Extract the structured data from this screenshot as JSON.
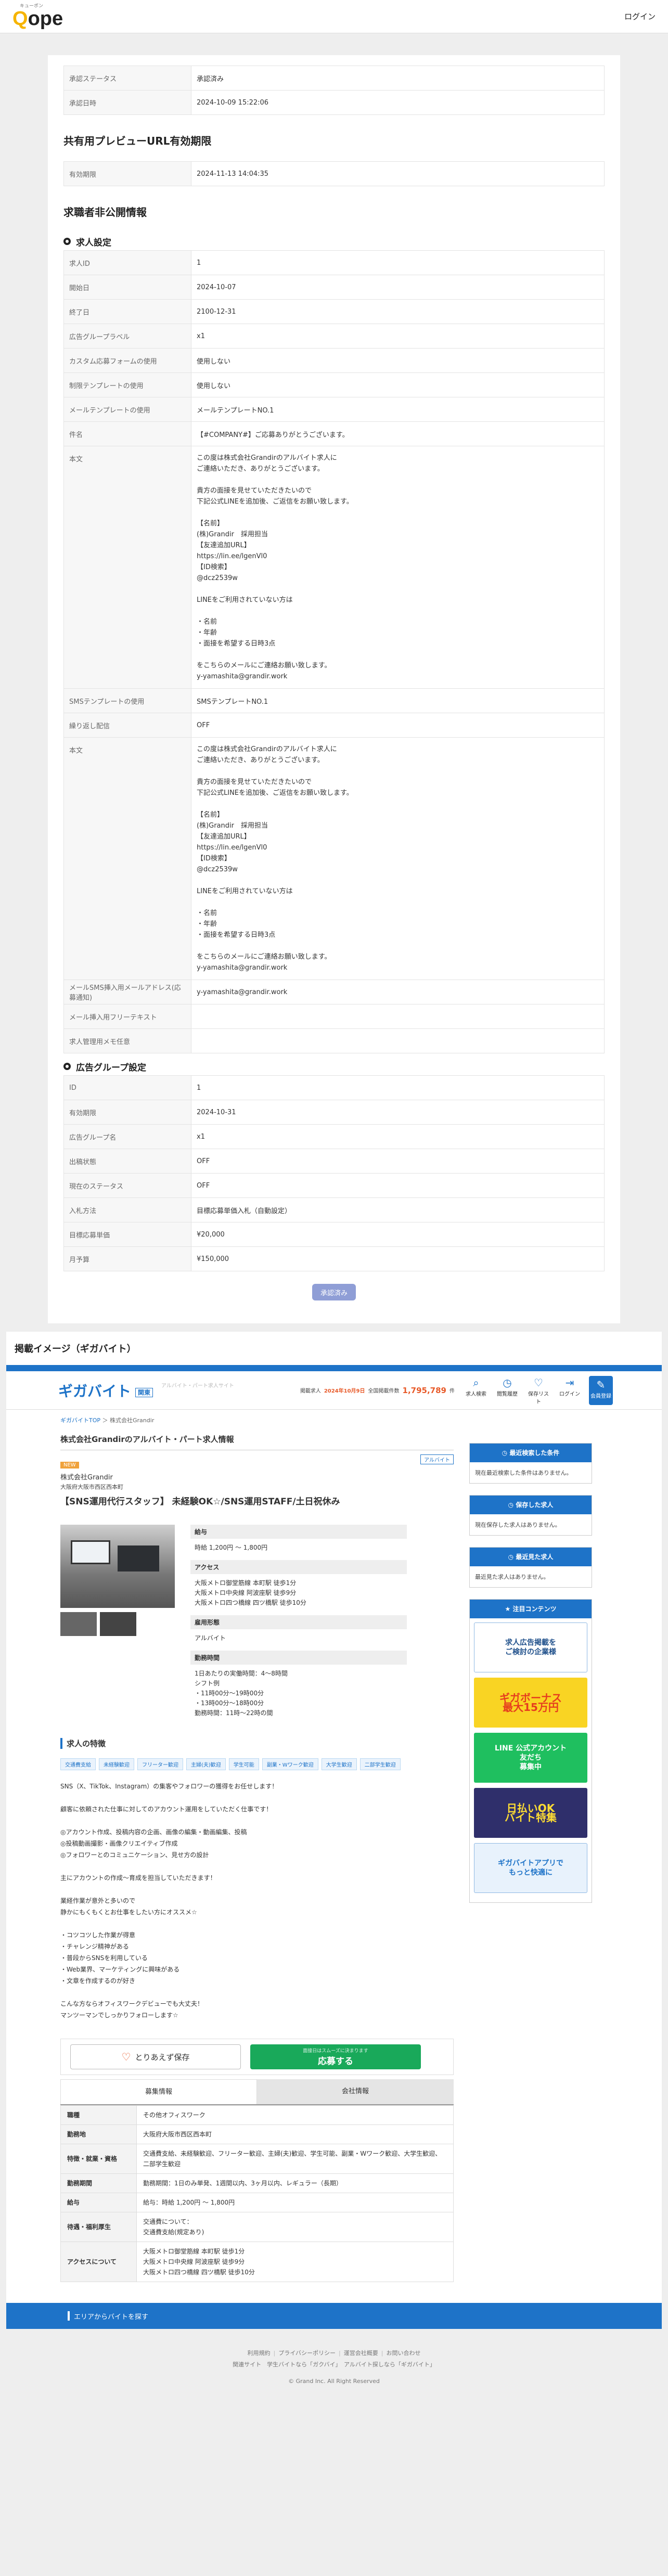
{
  "header": {
    "logo_kana": "キューポン",
    "logo_text": "Qope",
    "login": "ログイン"
  },
  "approval": {
    "rows": [
      {
        "k": "承認ステータス",
        "v": "承認済み"
      },
      {
        "k": "承認日時",
        "v": "2024-10-09 15:22:06"
      }
    ]
  },
  "preview_url": {
    "title": "共有用プレビューURL有効期限",
    "rows": [
      {
        "k": "有効期限",
        "v": "2024-11-13 14:04:35"
      }
    ]
  },
  "private_info": {
    "title": "求職者非公開情報",
    "job_settings": {
      "title": "求人設定",
      "rows": [
        {
          "k": "求人ID",
          "v": "1"
        },
        {
          "k": "開始日",
          "v": "2024-10-07"
        },
        {
          "k": "終了日",
          "v": "2100-12-31"
        },
        {
          "k": "広告グループラベル",
          "v": "x1"
        },
        {
          "k": "カスタム応募フォームの使用",
          "v": "使用しない"
        },
        {
          "k": "制限テンプレートの使用",
          "v": "使用しない"
        },
        {
          "k": "メールテンプレートの使用",
          "v": "メールテンプレートNO.1"
        },
        {
          "k": "件名",
          "v": "【#COMPANY#】ご応募ありがとうございます。"
        },
        {
          "k": "本文",
          "v": "この度は株式会社Grandirのアルバイト求人に\nご連絡いただき、ありがとうございます。\n\n貴方の面接を見せていただきたいので\n下記公式LINEを追加後、ご返信をお願い致します。\n\n【名前】\n(株)Grandir　採用担当\n【友達追加URL】\nhttps://lin.ee/lgenVl0\n【ID検索】\n@dcz2539w\n\nLINEをご利用されていない方は\n\n・名前\n・年齢\n・面接を希望する日時3点\n\nをこちらのメールにご連絡お願い致します。\ny-yamashita@grandir.work"
        },
        {
          "k": "SMSテンプレートの使用",
          "v": "SMSテンプレートNO.1"
        },
        {
          "k": "繰り返し配信",
          "v": "OFF"
        },
        {
          "k": "本文",
          "v": "この度は株式会社Grandirのアルバイト求人に\nご連絡いただき、ありがとうございます。\n\n貴方の面接を見せていただきたいので\n下記公式LINEを追加後、ご返信をお願い致します。\n\n【名前】\n(株)Grandir　採用担当\n【友達追加URL】\nhttps://lin.ee/lgenVl0\n【ID検索】\n@dcz2539w\n\nLINEをご利用されていない方は\n\n・名前\n・年齢\n・面接を希望する日時3点\n\nをこちらのメールにご連絡お願い致します。\ny-yamashita@grandir.work"
        },
        {
          "k": "メールSMS挿入用メールアドレス(応募通知)",
          "v": "y-yamashita@grandir.work"
        },
        {
          "k": "メール挿入用フリーテキスト",
          "v": ""
        },
        {
          "k": "求人管理用メモ任意",
          "v": ""
        }
      ]
    },
    "ad_group": {
      "title": "広告グループ設定",
      "rows": [
        {
          "k": "ID",
          "v": "1"
        },
        {
          "k": "有効期限",
          "v": "2024-10-31"
        },
        {
          "k": "広告グループ名",
          "v": "x1"
        },
        {
          "k": "出稿状態",
          "v": "OFF"
        },
        {
          "k": "現在のステータス",
          "v": "OFF"
        },
        {
          "k": "入札方法",
          "v": "目標応募単価入札（自動設定）"
        },
        {
          "k": "目標応募単価",
          "v": "¥20,000"
        },
        {
          "k": "月予算",
          "v": "¥150,000"
        }
      ]
    },
    "approved_button": "承認済み"
  },
  "preview": {
    "title": "掲載イメージ（ギガバイト）",
    "site": {
      "logo": "ギガバイト",
      "area": "関東",
      "tagline": "アルバイト・パート求人サイト",
      "count_label": "掲載求人",
      "count_new": "2024年10月9日",
      "count_sep": "全国掲載件数",
      "count_total": "1,795,789",
      "count_unit": "件",
      "nav": [
        {
          "glyph": "⌕",
          "label": "求人検索",
          "name": "search-icon"
        },
        {
          "glyph": "◷",
          "label": "閲覧履歴",
          "name": "history-icon"
        },
        {
          "glyph": "♡",
          "label": "保存リスト",
          "name": "heart-icon"
        },
        {
          "glyph": "⇥",
          "label": "ログイン",
          "name": "login-icon"
        },
        {
          "glyph": "✎",
          "label": "会員登録",
          "name": "register-icon"
        }
      ]
    },
    "breadcrumb": {
      "home": "ギガバイトTOP",
      "sep": "＞",
      "current": "株式会社Grandir"
    },
    "job": {
      "heading": "株式会社Grandirのアルバイト・パート求人情報",
      "badge": "NEW",
      "type": "アルバイト",
      "company": "株式会社Grandir",
      "address": "大阪府大阪市西区西本町",
      "title": "【SNS運用代行スタッフ】 未経験OK☆/SNS運用STAFF/土日祝休み",
      "info": [
        {
          "k": "給与",
          "v": "時給 1,200円 〜 1,800円"
        },
        {
          "k": "アクセス",
          "v": "大阪メトロ御堂筋線 本町駅 徒歩1分\n大阪メトロ中央線 阿波座駅 徒歩9分\n大阪メトロ四つ橋線 四ツ橋駅 徒歩10分"
        },
        {
          "k": "雇用形態",
          "v": "アルバイト"
        },
        {
          "k": "勤務時間",
          "v": "1日あたりの実働時間：4〜8時間\nシフト例\n・11時00分〜19時00分\n・13時00分〜18時00分\n勤務時間：11時〜22時の間"
        }
      ],
      "features_title": "求人の特徴",
      "features": [
        "交通費支給",
        "未経験歓迎",
        "フリーター歓迎",
        "主婦(夫)歓迎",
        "学生可能",
        "副業・Wワーク歓迎",
        "大学生歓迎",
        "二部学生歓迎"
      ],
      "description": "SNS（X、TikTok、Instagram）の集客やフォロワーの獲得をお任せします！\n\n顧客に依頼された仕事に対してのアカウント運用をしていただく仕事です！\n\n◎アカウント作成、投稿内容の企画、画像の編集・動画編集、投稿\n◎投稿動画撮影・画像クリエイティブ作成\n◎フォロワーとのコミュニケーション、見せ方の設計\n\n主にアカウントの作成〜育成を担当していただきます！\n\n業経作業が意外と多いので\n静かにもくもくとお仕事をしたい方にオススメ☆\n\n・コツコツした作業が得意\n・チャレンジ精神がある\n・普段からSNSを利用している\n・Web業界、マーケティングに興味がある\n・文章を作成するのが好き\n\nこんな方ならオフィスワークデビューでも大丈夫！\nマンツーマンでしっかりフォローします☆"
    },
    "actions": {
      "save": "とりあえず保存",
      "apply_sub": "面接日はスムーズに決まります",
      "apply": "応募する"
    },
    "tabs": {
      "job": "募集情報",
      "company": "会社情報"
    },
    "info_table": [
      {
        "k": "職種",
        "v": "その他オフィスワーク"
      },
      {
        "k": "勤務地",
        "v": "大阪府大阪市西区西本町"
      },
      {
        "k": "特徴・就業・資格",
        "v": "交通費支給、未経験歓迎、フリーター歓迎、主婦(夫)歓迎、学生可能、副業・Wワーク歓迎、大学生歓迎、二部学生歓迎"
      },
      {
        "k": "勤務期間",
        "v": "勤務期間：1日のみ単発、1週間以内、3ヶ月以内、レギュラー（長期）"
      },
      {
        "k": "給与",
        "v": "給与：時給 1,200円 〜 1,800円"
      },
      {
        "k": "待遇・福利厚生",
        "v": "交通費について：\n交通費支給(規定あり)"
      },
      {
        "k": "アクセスについて",
        "v": "大阪メトロ御堂筋線 本町駅 徒歩1分\n大阪メトロ中央線 阿波座駅 徒歩9分\n大阪メトロ四つ橋線 四ツ橋駅 徒歩10分"
      }
    ],
    "sidebar": {
      "boxes": [
        {
          "title": "最近検索した条件",
          "body": "現在最近検索した条件はありません。"
        },
        {
          "title": "保存した求人",
          "body": "現在保存した求人はありません。"
        },
        {
          "title": "最近見た求人",
          "body": "最近見た求人はありません。"
        }
      ],
      "ads_title": "注目コンテンツ",
      "ads": [
        "求人広告掲載を\nご検討の企業様",
        "ギガボーナス\n最大15万円",
        "LINE 公式アカウント\n友だち\n募集中",
        "日払いOK\nバイト特集",
        "ギガバイトアプリで\nもっと快適に"
      ]
    },
    "area_bar": "エリアからバイトを探す",
    "footer": {
      "links": [
        "利用規約",
        "プライバシーポリシー",
        "運営会社概要",
        "お問い合わせ"
      ],
      "related": "関連サイト　学生バイトなら「ガクバイ」　アルバイト探しなら「ギガバイト」",
      "copyright": "© Grand Inc. All Right Reserved"
    }
  }
}
